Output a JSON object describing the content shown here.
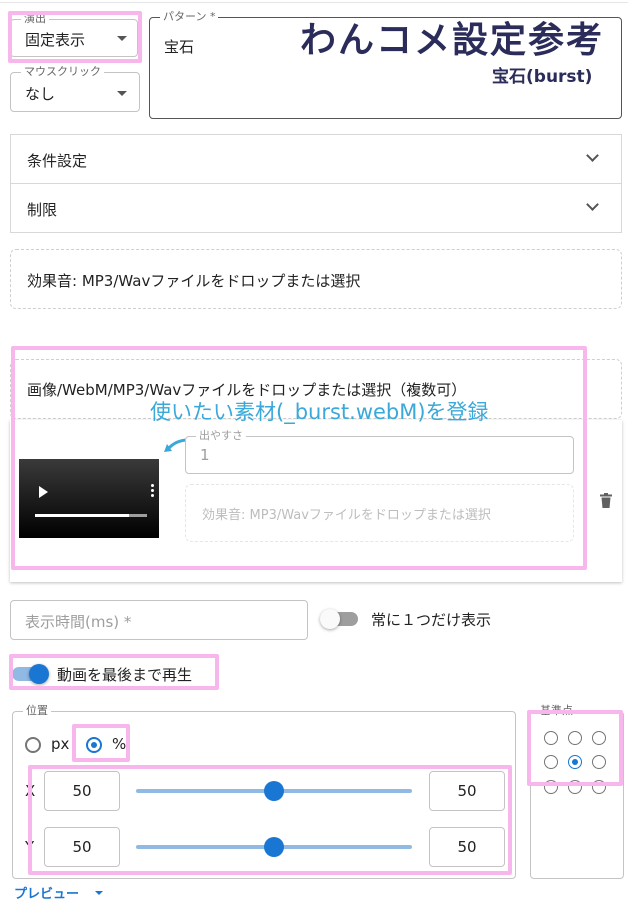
{
  "effect": {
    "legend": "演出",
    "value": "固定表示"
  },
  "mouse_click": {
    "legend": "マウスクリック",
    "value": "なし"
  },
  "pattern": {
    "legend": "パターン *",
    "value": "宝石"
  },
  "overlay": {
    "title": "わんコメ設定参考",
    "subtitle": "宝石(burst)",
    "note": "使いたい素材(_burst.webM)を登録"
  },
  "accordions": {
    "conditions": "条件設定",
    "limits": "制限"
  },
  "sound_drop": "効果音: MP3/Wavファイルをドロップまたは選択",
  "media_drop": "画像/WebM/MP3/Wavファイルをドロップまたは選択（複数可）",
  "media_item": {
    "frequency_legend": "出やすさ",
    "frequency_value": "1",
    "sound_drop": "効果音: MP3/Wavファイルをドロップまたは選択"
  },
  "display_time_placeholder": "表示時間(ms) *",
  "only_one_label": "常に１つだけ表示",
  "play_to_end_label": "動画を最後まで再生",
  "position": {
    "legend": "位置",
    "unit_px": "px",
    "unit_percent": "%",
    "x_label": "X",
    "y_label": "Y",
    "x_value": "50",
    "y_value": "50",
    "x_slider": 0.5,
    "y_slider": 0.5
  },
  "anchor": {
    "legend": "基準点",
    "selected": "center"
  },
  "preview_label": "プレビュー",
  "colors": {
    "accent": "#1976d2",
    "annotation": "#f7b6ec",
    "title_ink": "#2b2c5a",
    "note": "#3aa8d8"
  }
}
